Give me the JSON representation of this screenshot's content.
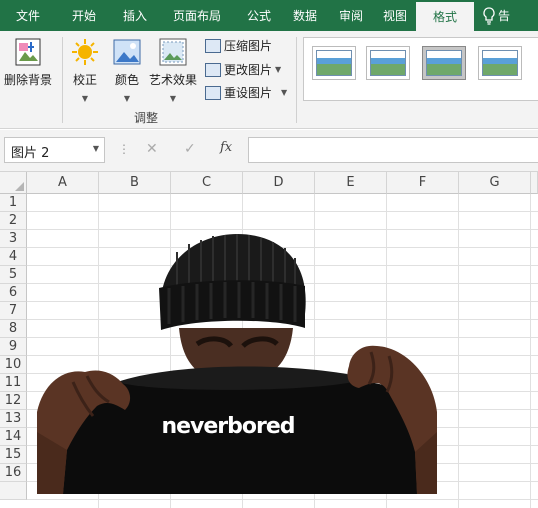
{
  "tabs": [
    {
      "label": "文件",
      "active": false
    },
    {
      "label": "开始",
      "active": false
    },
    {
      "label": "插入",
      "active": false
    },
    {
      "label": "页面布局",
      "active": false
    },
    {
      "label": "公式",
      "active": false
    },
    {
      "label": "数据",
      "active": false
    },
    {
      "label": "审阅",
      "active": false
    },
    {
      "label": "视图",
      "active": false
    },
    {
      "label": "格式",
      "active": true
    }
  ],
  "help_icon": "lightbulb-icon",
  "help_partial": "告",
  "ribbon": {
    "remove_bg": "删除背景",
    "corrections": "校正",
    "color": "颜色",
    "artistic": "艺术效果",
    "compress": "压缩图片",
    "change": "更改图片",
    "reset": "重设图片",
    "group_adjust": "调整"
  },
  "formula_bar": {
    "name_box": "图片 2",
    "fx_label": "fx",
    "formula": ""
  },
  "columns": [
    "A",
    "B",
    "C",
    "D",
    "E",
    "F",
    "G"
  ],
  "rows": [
    "1",
    "2",
    "3",
    "4",
    "5",
    "6",
    "7",
    "8",
    "9",
    "10",
    "11",
    "12",
    "13",
    "14",
    "15",
    "16"
  ],
  "picture": {
    "name": "图片 2",
    "shirt_text": "neverbored"
  },
  "colors": {
    "accent": "#217346",
    "ribbon": "#f3f3f3"
  }
}
